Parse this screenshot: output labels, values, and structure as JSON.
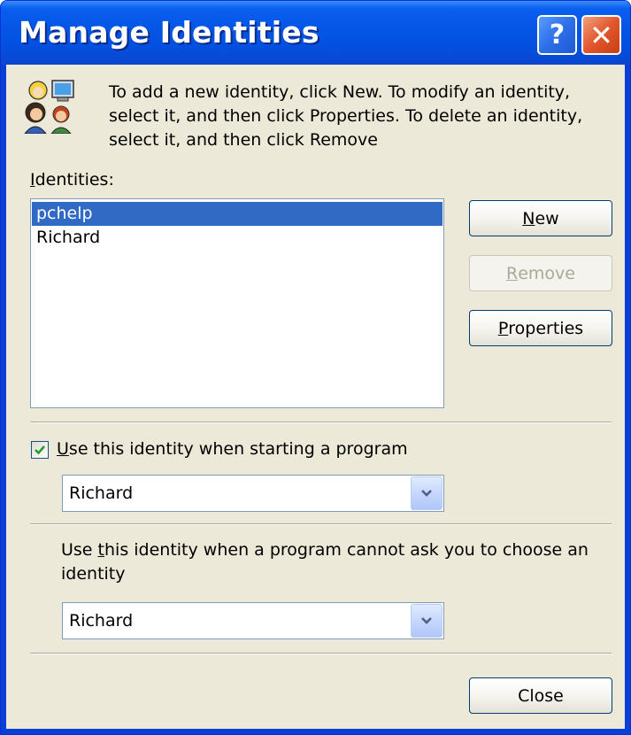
{
  "window": {
    "title": "Manage Identities",
    "help_glyph": "?",
    "close_glyph": "✕"
  },
  "intro": {
    "line1": "To add a new identity, click New.  To modify an identity,",
    "line2": "select it, and then click Properties.  To delete an identity,",
    "line3": "select it, and then click Remove",
    "icon": "identities-icon"
  },
  "identities": {
    "label_u": "I",
    "label_rest": "dentities:",
    "items": [
      "pchelp",
      "Richard"
    ],
    "selected_index": 0
  },
  "buttons": {
    "new_u": "N",
    "new_rest": "ew",
    "remove_u": "R",
    "remove_rest": "emove",
    "properties_u": "P",
    "properties_rest": "roperties",
    "close": "Close"
  },
  "startup": {
    "checkbox_checked": true,
    "label_u": "U",
    "label_rest": "se this identity when starting a program",
    "selected": "Richard"
  },
  "fallback": {
    "label_pre": "Use ",
    "label_u": "t",
    "label_post": "his identity when a program cannot ask you to choose an",
    "label_line2": "identity",
    "selected": "Richard"
  },
  "colors": {
    "selection": "#316ac5",
    "titlebar": "#0556e6",
    "dialog_bg": "#ece9d8",
    "check": "#21a121"
  }
}
